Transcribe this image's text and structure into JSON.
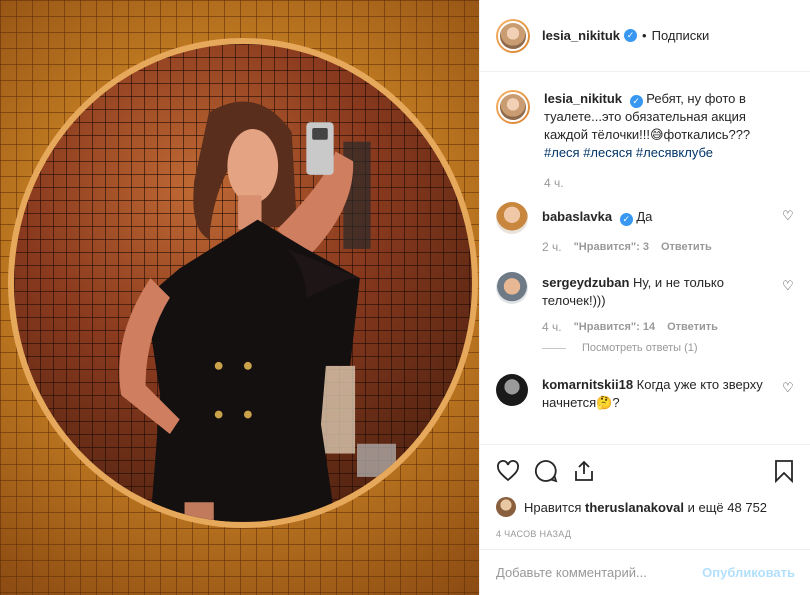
{
  "post": {
    "username": "lesia_nikituk",
    "follow_label": "Подписки",
    "dot": "•"
  },
  "caption": {
    "username": "lesia_nikituk",
    "text": "Ребят, ну фото в туалете...это обязательная акция каждой тёлочки!!!😅фоткались???",
    "hashtags": "#леся #лесяся #лесявклубе",
    "time": "4 ч."
  },
  "comments": [
    {
      "username": "babaslavka",
      "verified": true,
      "text": "Да",
      "time": "2 ч.",
      "likes": "\"Нравится\": 3",
      "reply": "Ответить"
    },
    {
      "username": "sergeydzuban",
      "verified": false,
      "text": "Ну, и не только телочек!)))",
      "time": "4 ч.",
      "likes": "\"Нравится\": 14",
      "reply": "Ответить",
      "view_replies": "Посмотреть ответы (1)"
    },
    {
      "username": "komarnitskii18",
      "verified": false,
      "text": "Когда уже кто зверху начнется🤔?"
    }
  ],
  "likes": {
    "prefix": "Нравится",
    "user": "theruslanakoval",
    "suffix": "и ещё 48 752"
  },
  "timestamp": "4 ЧАСОВ НАЗАД",
  "add_comment": {
    "placeholder": "Добавьте комментарий...",
    "publish_label": "Опубликовать"
  },
  "icons": {
    "verified": "✓",
    "heart": "♡"
  },
  "colors": {
    "link": "#003569",
    "verified": "#3897f0",
    "publish_disabled": "#b2dffc",
    "muted": "#999999"
  }
}
